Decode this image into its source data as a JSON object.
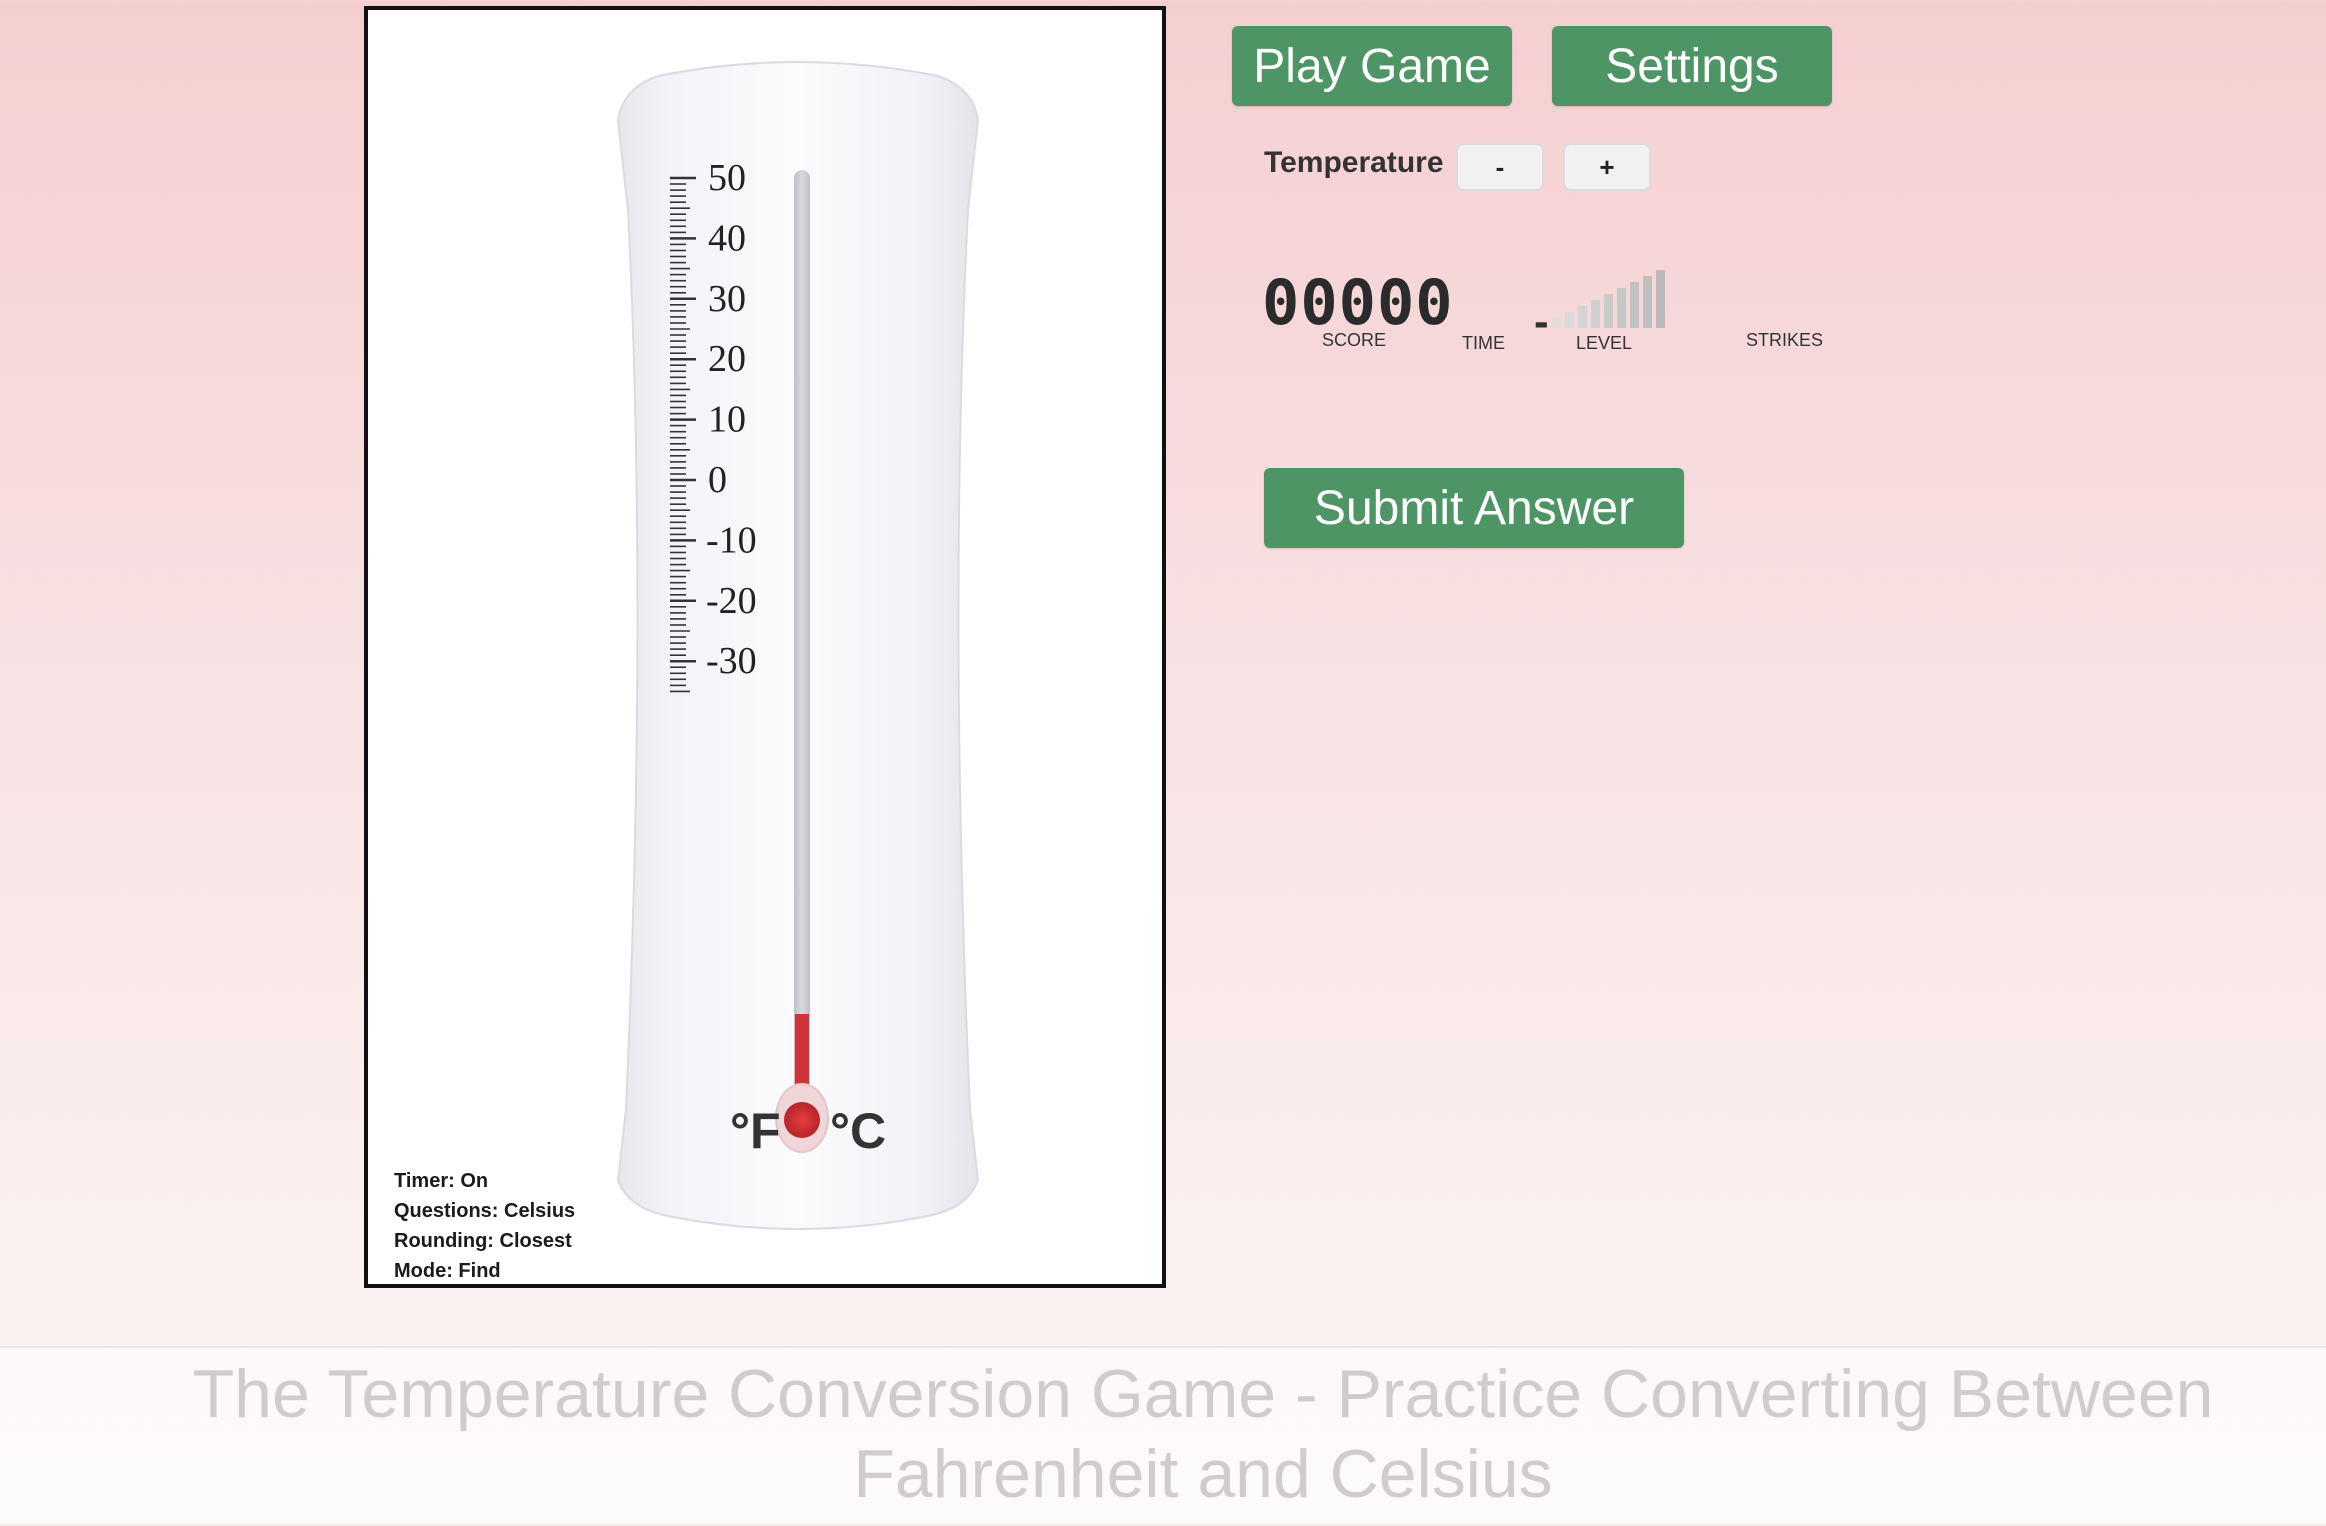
{
  "thermometer": {
    "celsius_scale_labels": [
      "50",
      "40",
      "30",
      "20",
      "10",
      "0",
      "-10",
      "-20",
      "-30"
    ],
    "fahrenheit_unit": "°F",
    "celsius_unit": "°C",
    "mercury_color": "#d0343a"
  },
  "settings_summary": {
    "timer": "Timer: On",
    "questions": "Questions: Celsius",
    "rounding": "Rounding: Closest",
    "mode": "Mode: Find"
  },
  "controls": {
    "play_label": "Play Game",
    "settings_label": "Settings",
    "temperature_label": "Temperature",
    "minus_label": "-",
    "plus_label": "+",
    "submit_label": "Submit Answer"
  },
  "stats": {
    "score_value": "00000",
    "score_label": "SCORE",
    "time_label": "TIME",
    "level_value": "-",
    "level_label": "LEVEL",
    "strikes_label": "STRIKES"
  },
  "colors": {
    "button_green": "#4e9566",
    "background_top": "#f5cfd0",
    "title_text": "#d0cccc"
  },
  "footer": {
    "title": "The Temperature Conversion Game - Practice Converting Between Fahrenheit and Celsius"
  }
}
